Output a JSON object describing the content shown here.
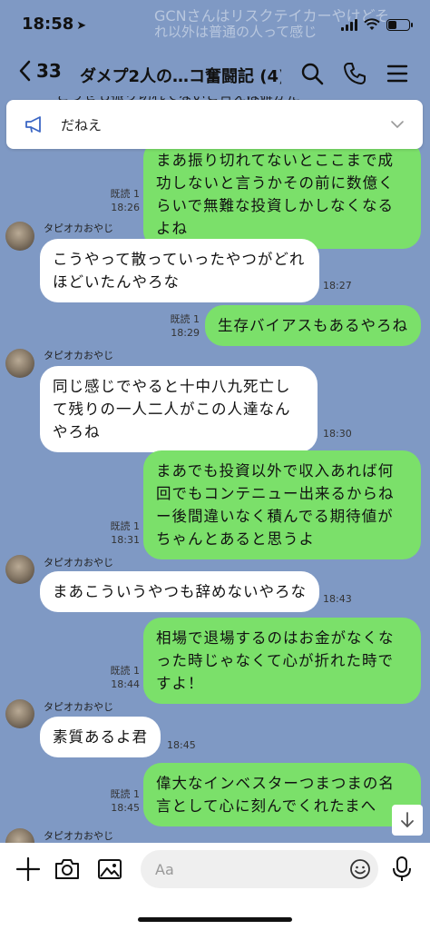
{
  "status": {
    "time": "18:58",
    "location_arrow": "➤"
  },
  "notification_ghost": {
    "line1": "GCNさんはリスクテイカーやけどそ",
    "line2": "れ以外は普通の人って感じ"
  },
  "header": {
    "back_count": "33",
    "title": "ダメプ2人の…コ奮闘記 (4)"
  },
  "announcement": {
    "text": "だねえ"
  },
  "chat": {
    "top_fragment": "どうせも振り切れてないと言えば確かだ",
    "messages": [
      {
        "from": "me",
        "text": "まあ振り切れてないとここまで成功しないと言うかその前に数億くらいで無難な投資しかしなくなるよね",
        "read": "既読 1",
        "time": "18:26"
      },
      {
        "from": "them",
        "sender": "タピオカおやじ",
        "text": "こうやって散っていったやつがどれほどいたんやろな",
        "time": "18:27"
      },
      {
        "from": "me",
        "text": "生存バイアスもあるやろね",
        "read": "既読 1",
        "time": "18:29"
      },
      {
        "from": "them",
        "sender": "タピオカおやじ",
        "text": "同じ感じでやると十中八九死亡して残りの一人二人がこの人達なんやろね",
        "time": "18:30"
      },
      {
        "from": "me",
        "text": "まあでも投資以外で収入あれば何回でもコンテニュー出来るからねー後間違いなく積んでる期待値がちゃんとあると思うよ",
        "read": "既読 1",
        "time": "18:31"
      },
      {
        "from": "them",
        "sender": "タピオカおやじ",
        "text": "まあこういうやつも辞めないやろな",
        "time": "18:43"
      },
      {
        "from": "me",
        "text": "相場で退場するのはお金がなくなった時じゃなくて心が折れた時ですよ！",
        "read": "既読 1",
        "time": "18:44"
      },
      {
        "from": "them",
        "sender": "タピオカおやじ",
        "text": "素質あるよ君",
        "time": "18:45"
      },
      {
        "from": "me",
        "text": "偉大なインベスターつまつまの名言として心に刻んでくれたまへ",
        "read": "既読 1",
        "time": "18:45"
      },
      {
        "from": "them",
        "sender": "タピオカおやじ"
      }
    ]
  },
  "input": {
    "placeholder": "Aa"
  },
  "icons": {
    "back": "chevron-left-icon",
    "search": "search-icon",
    "call": "phone-icon",
    "menu": "hamburger-menu-icon",
    "announce": "megaphone-icon",
    "expand": "chevron-down-icon",
    "scroll": "arrow-down-icon",
    "plus": "plus-icon",
    "camera": "camera-icon",
    "image": "image-icon",
    "emoji": "emoji-icon",
    "mic": "microphone-icon"
  }
}
